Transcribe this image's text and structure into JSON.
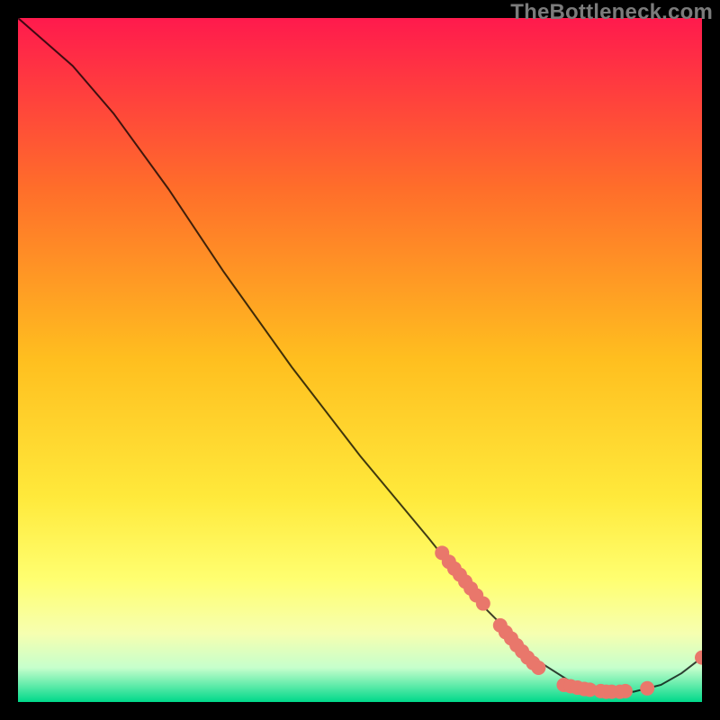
{
  "attribution": "TheBottleneck.com",
  "chart_data": {
    "type": "line",
    "title": "",
    "xlabel": "",
    "ylabel": "",
    "xlim": [
      0,
      100
    ],
    "ylim": [
      0,
      100
    ],
    "grid": false,
    "legend": false,
    "background_gradient": {
      "top_color": "#ff1a4d",
      "mid_colors": [
        "#ff7f2a",
        "#ffd400",
        "#ffff66"
      ],
      "bottom_color": "#00d98a"
    },
    "curve": {
      "stroke": "#000000",
      "stroke_opacity": 0.75,
      "points_xy": [
        [
          0,
          100
        ],
        [
          8,
          93
        ],
        [
          14,
          86
        ],
        [
          22,
          75
        ],
        [
          30,
          63
        ],
        [
          40,
          49
        ],
        [
          50,
          36
        ],
        [
          60,
          24
        ],
        [
          68,
          14
        ],
        [
          76,
          6
        ],
        [
          82,
          2.2
        ],
        [
          86,
          1.5
        ],
        [
          90,
          1.5
        ],
        [
          94,
          2.5
        ],
        [
          97,
          4.2
        ],
        [
          100,
          6.5
        ]
      ]
    },
    "markers": {
      "fill": "#e9776b",
      "radius": 8,
      "points_xy": [
        [
          62.0,
          21.8
        ],
        [
          63.0,
          20.5
        ],
        [
          63.8,
          19.5
        ],
        [
          64.6,
          18.6
        ],
        [
          65.4,
          17.6
        ],
        [
          66.2,
          16.6
        ],
        [
          67.0,
          15.6
        ],
        [
          68.0,
          14.4
        ],
        [
          70.5,
          11.2
        ],
        [
          71.3,
          10.2
        ],
        [
          72.1,
          9.3
        ],
        [
          72.9,
          8.3
        ],
        [
          73.7,
          7.4
        ],
        [
          74.5,
          6.5
        ],
        [
          75.3,
          5.7
        ],
        [
          76.1,
          5.0
        ],
        [
          79.8,
          2.5
        ],
        [
          80.8,
          2.3
        ],
        [
          81.8,
          2.1
        ],
        [
          82.8,
          1.9
        ],
        [
          83.6,
          1.8
        ],
        [
          85.2,
          1.6
        ],
        [
          86.0,
          1.5
        ],
        [
          86.8,
          1.5
        ],
        [
          88.0,
          1.5
        ],
        [
          88.8,
          1.6
        ],
        [
          92.0,
          2.0
        ],
        [
          100.0,
          6.5
        ]
      ]
    }
  }
}
